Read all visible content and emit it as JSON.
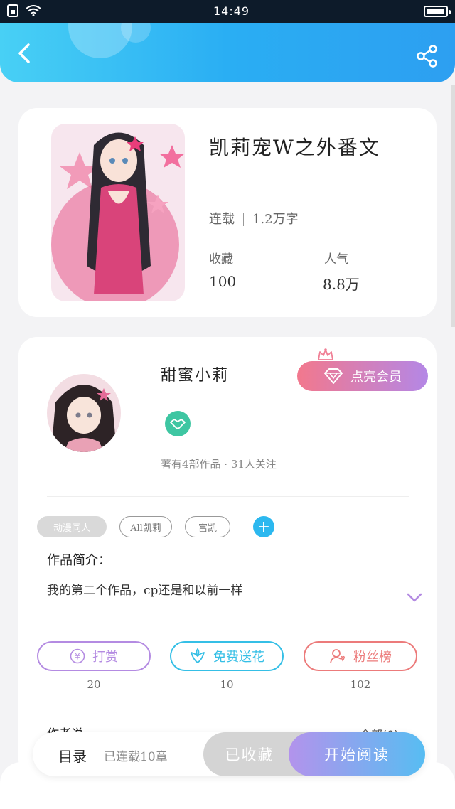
{
  "status_bar": {
    "time": "14:49"
  },
  "book": {
    "title": "凯莉宠W之外番文",
    "status": "连载",
    "word_count": "1.2万字",
    "favorites_label": "收藏",
    "favorites_value": "100",
    "popularity_label": "人气",
    "popularity_value": "8.8万"
  },
  "author": {
    "name": "甜蜜小莉",
    "vip_button": "点亮会员",
    "meta": "著有4部作品 · 31人关注"
  },
  "tags": [
    "动漫同人",
    "All凯莉",
    "富凯"
  ],
  "intro": {
    "heading": "作品简介：",
    "text": "我的第二个作品，cp还是和以前一样"
  },
  "actions": [
    {
      "label": "打赏",
      "count": "20",
      "color": "#b48be2",
      "icon": "yen-icon"
    },
    {
      "label": "免费送花",
      "count": "10",
      "color": "#35bfe6",
      "icon": "flower-icon"
    },
    {
      "label": "粉丝榜",
      "count": "102",
      "color": "#ec7b7b",
      "icon": "fan-icon"
    }
  ],
  "author_says": {
    "heading": "作者说",
    "comments": "全部(0)"
  },
  "bottom": {
    "toc_label": "目录",
    "progress": "已连载10章",
    "saved_button": "已收藏",
    "read_button": "开始阅读"
  }
}
